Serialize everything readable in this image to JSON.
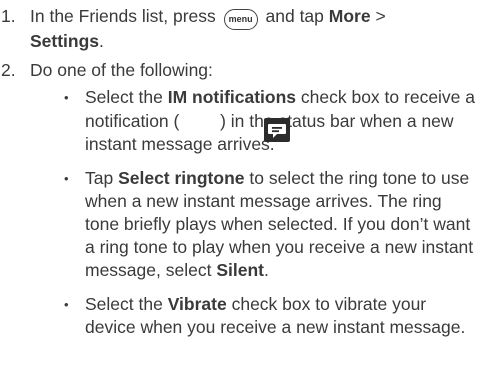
{
  "steps": [
    {
      "number": "1.",
      "parts": [
        "In the Friends list, press ",
        " and tap ",
        "More",
        " > ",
        "Settings",
        "."
      ],
      "menu_key": "menu"
    },
    {
      "number": "2.",
      "text": "Do one of the following:"
    }
  ],
  "bullets": [
    {
      "parts": [
        "Select the ",
        "IM notifications",
        " check box to receive a notification ( ",
        " ) in the status bar when a new instant message arrives."
      ],
      "icon": "im-notification-icon"
    },
    {
      "parts": [
        "Tap ",
        "Select ringtone",
        " to select the ring tone to use when a new instant message arrives. The ring tone briefly plays when selected. If you don’t want a ring tone to play when you receive a new instant message, select ",
        "Silent",
        "."
      ]
    },
    {
      "parts": [
        "Select the ",
        "Vibrate",
        " check box to vibrate your device when you receive a new instant message."
      ]
    }
  ],
  "bullet_glyph": "•",
  "colors": {
    "text": "#3a3a3a",
    "icon_bg": "#2c2c2c"
  }
}
